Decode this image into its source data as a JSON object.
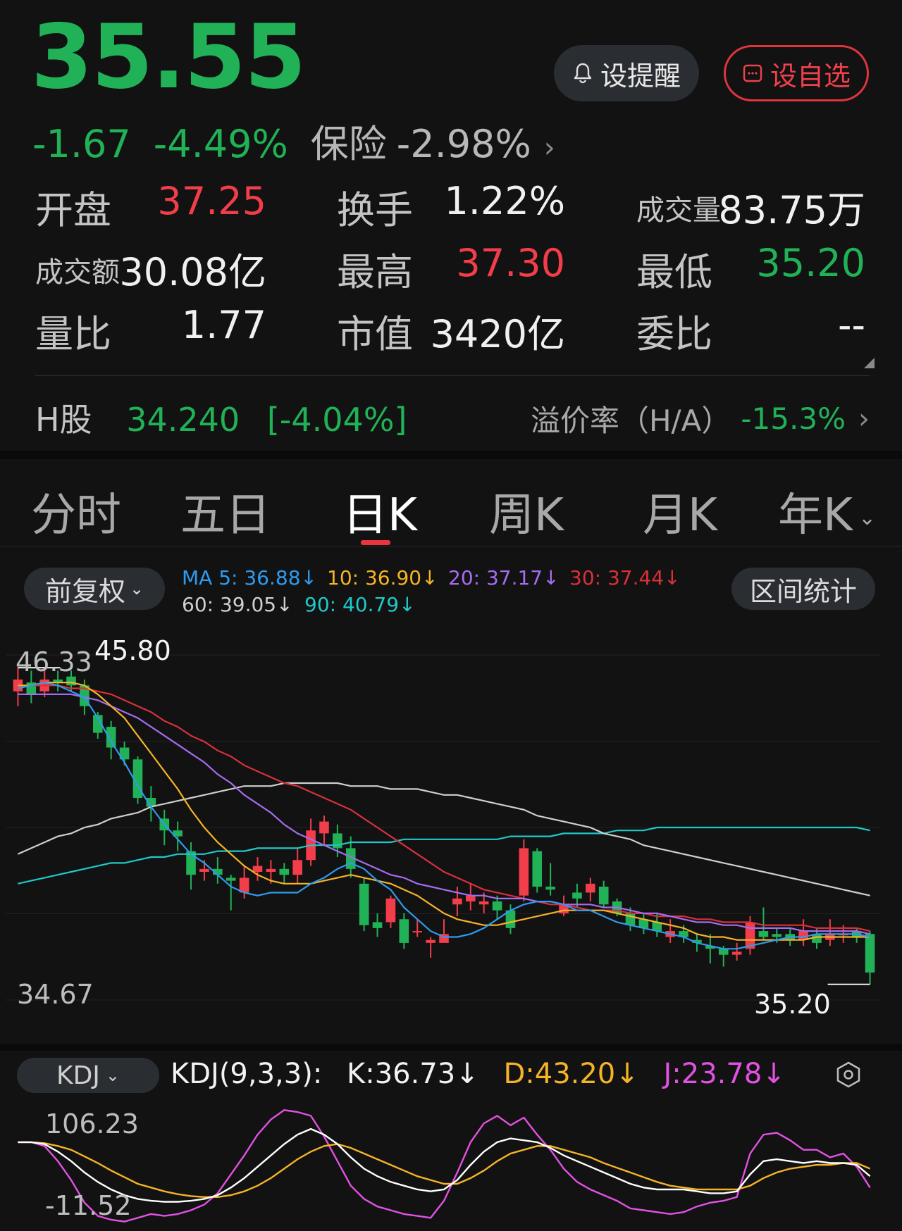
{
  "quote": {
    "price": "35.55",
    "change": "-1.67",
    "change_pct": "-4.49%",
    "sector_name": "保险",
    "sector_change": "-2.98%"
  },
  "buttons": {
    "remind": "设提醒",
    "watchlist": "设自选"
  },
  "stats": {
    "open_label": "开盘",
    "open_value": "37.25",
    "turnover_label": "换手",
    "turnover_value": "1.22%",
    "volume_label": "成交量",
    "volume_value": "83.75万",
    "amount_label": "成交额",
    "amount_value": "30.08亿",
    "high_label": "最高",
    "high_value": "37.30",
    "low_label": "最低",
    "low_value": "35.20",
    "vol_ratio_label": "量比",
    "vol_ratio_value": "1.77",
    "mkt_cap_label": "市值",
    "mkt_cap_value": "3420亿",
    "order_ratio_label": "委比",
    "order_ratio_value": "--"
  },
  "h_share": {
    "label": "H股",
    "value": "34.240",
    "change": "[-4.04%]",
    "premium_label": "溢价率（H/A）",
    "premium_value": "-15.3%"
  },
  "tabs": [
    "分时",
    "五日",
    "日K",
    "周K",
    "月K",
    "年K"
  ],
  "toolbar": {
    "adjust": "前复权",
    "range_stats": "区间统计"
  },
  "ma": {
    "ma5": "MA 5: 36.88↓",
    "ma10": "10: 36.90↓",
    "ma20": "20: 37.17↓",
    "ma30": "30: 37.44↓",
    "ma60": "60: 39.05↓",
    "ma90": "90: 40.79↓"
  },
  "colors": {
    "up": "#f23d4a",
    "down": "#21b257",
    "ma5": "#2e9bef",
    "ma10": "#f5b327",
    "ma20": "#a46cf0",
    "ma30": "#d9303a",
    "ma60": "#cfcfcf",
    "ma90": "#1fc9c9",
    "kdj_k": "#ffffff",
    "kdj_d": "#f5b327",
    "kdj_j": "#e152e2"
  },
  "chart_labels": {
    "y_top": "46.33",
    "y_bottom": "34.67",
    "max_label": "45.80",
    "min_label": "35.20"
  },
  "kdj": {
    "button": "KDJ",
    "title": "KDJ(9,3,3):",
    "k": "K:36.73↓",
    "d": "D:43.20↓",
    "j": "J:23.78↓",
    "y_top": "106.23",
    "y_bottom": "-11.52"
  },
  "chart_data": {
    "type": "candlestick",
    "ylim": [
      34.67,
      46.33
    ],
    "candles": [
      {
        "o": 45.1,
        "c": 45.5,
        "h": 45.9,
        "l": 44.6
      },
      {
        "o": 45.4,
        "c": 45.0,
        "h": 45.8,
        "l": 44.7
      },
      {
        "o": 45.1,
        "c": 45.5,
        "h": 45.8,
        "l": 44.9
      },
      {
        "o": 45.5,
        "c": 45.4,
        "h": 45.8,
        "l": 45.1
      },
      {
        "o": 45.6,
        "c": 45.3,
        "h": 45.8,
        "l": 45.1
      },
      {
        "o": 45.3,
        "c": 44.6,
        "h": 45.5,
        "l": 44.3
      },
      {
        "o": 44.3,
        "c": 43.7,
        "h": 44.4,
        "l": 43.5
      },
      {
        "o": 43.9,
        "c": 43.2,
        "h": 44.1,
        "l": 42.8
      },
      {
        "o": 43.2,
        "c": 42.8,
        "h": 43.4,
        "l": 42.6
      },
      {
        "o": 42.8,
        "c": 41.5,
        "h": 42.9,
        "l": 41.3
      },
      {
        "o": 41.5,
        "c": 41.2,
        "h": 41.9,
        "l": 40.7
      },
      {
        "o": 40.8,
        "c": 40.4,
        "h": 41.1,
        "l": 39.9
      },
      {
        "o": 40.4,
        "c": 40.2,
        "h": 40.7,
        "l": 39.7
      },
      {
        "o": 39.7,
        "c": 38.9,
        "h": 40.0,
        "l": 38.4
      },
      {
        "o": 39.0,
        "c": 39.1,
        "h": 39.4,
        "l": 38.7
      },
      {
        "o": 39.1,
        "c": 38.9,
        "h": 39.5,
        "l": 38.6
      },
      {
        "o": 38.8,
        "c": 38.7,
        "h": 38.9,
        "l": 37.7
      },
      {
        "o": 38.3,
        "c": 38.8,
        "h": 39.2,
        "l": 38.1
      },
      {
        "o": 39.0,
        "c": 39.2,
        "h": 39.5,
        "l": 38.7
      },
      {
        "o": 39.0,
        "c": 39.1,
        "h": 39.4,
        "l": 38.6
      },
      {
        "o": 39.1,
        "c": 38.9,
        "h": 39.3,
        "l": 38.6
      },
      {
        "o": 38.9,
        "c": 39.4,
        "h": 39.8,
        "l": 38.6
      },
      {
        "o": 39.4,
        "c": 40.4,
        "h": 40.8,
        "l": 39.2
      },
      {
        "o": 40.3,
        "c": 40.7,
        "h": 40.9,
        "l": 39.9
      },
      {
        "o": 40.3,
        "c": 39.8,
        "h": 40.6,
        "l": 39.5
      },
      {
        "o": 39.8,
        "c": 39.1,
        "h": 40.2,
        "l": 38.8
      },
      {
        "o": 38.6,
        "c": 37.2,
        "h": 38.8,
        "l": 37.0
      },
      {
        "o": 37.3,
        "c": 37.1,
        "h": 37.6,
        "l": 36.8
      },
      {
        "o": 37.3,
        "c": 38.1,
        "h": 38.2,
        "l": 37.1
      },
      {
        "o": 37.4,
        "c": 36.6,
        "h": 37.6,
        "l": 36.4
      },
      {
        "o": 37.0,
        "c": 37.0,
        "h": 37.4,
        "l": 36.8
      },
      {
        "o": 36.6,
        "c": 36.7,
        "h": 36.8,
        "l": 36.1
      },
      {
        "o": 36.6,
        "c": 36.9,
        "h": 37.4,
        "l": 36.7
      },
      {
        "o": 37.9,
        "c": 38.1,
        "h": 38.5,
        "l": 37.5
      },
      {
        "o": 38.0,
        "c": 38.2,
        "h": 38.6,
        "l": 37.7
      },
      {
        "o": 37.9,
        "c": 38.0,
        "h": 38.3,
        "l": 37.6
      },
      {
        "o": 38.0,
        "c": 37.7,
        "h": 38.2,
        "l": 37.4
      },
      {
        "o": 37.7,
        "c": 37.1,
        "h": 37.9,
        "l": 36.9
      },
      {
        "o": 38.2,
        "c": 39.8,
        "h": 40.1,
        "l": 38.0
      },
      {
        "o": 39.7,
        "c": 38.5,
        "h": 39.8,
        "l": 38.3
      },
      {
        "o": 38.5,
        "c": 38.4,
        "h": 39.3,
        "l": 38.2
      },
      {
        "o": 37.6,
        "c": 37.9,
        "h": 38.2,
        "l": 37.5
      },
      {
        "o": 38.3,
        "c": 38.1,
        "h": 38.6,
        "l": 37.8
      },
      {
        "o": 38.3,
        "c": 38.6,
        "h": 38.8,
        "l": 38.0
      },
      {
        "o": 38.5,
        "c": 37.9,
        "h": 38.7,
        "l": 37.8
      },
      {
        "o": 38.0,
        "c": 37.6,
        "h": 38.1,
        "l": 37.5
      },
      {
        "o": 37.6,
        "c": 37.2,
        "h": 37.8,
        "l": 37.0
      },
      {
        "o": 37.4,
        "c": 37.1,
        "h": 37.6,
        "l": 36.9
      },
      {
        "o": 37.3,
        "c": 37.0,
        "h": 37.6,
        "l": 36.8
      },
      {
        "o": 36.8,
        "c": 37.0,
        "h": 37.4,
        "l": 36.6
      },
      {
        "o": 37.0,
        "c": 36.8,
        "h": 37.2,
        "l": 36.6
      },
      {
        "o": 36.7,
        "c": 36.6,
        "h": 36.9,
        "l": 36.3
      },
      {
        "o": 36.5,
        "c": 36.4,
        "h": 36.9,
        "l": 35.9
      },
      {
        "o": 36.4,
        "c": 36.2,
        "h": 36.5,
        "l": 35.8
      },
      {
        "o": 36.2,
        "c": 36.3,
        "h": 36.6,
        "l": 36.0
      },
      {
        "o": 36.4,
        "c": 37.3,
        "h": 37.5,
        "l": 36.2
      },
      {
        "o": 37.0,
        "c": 36.8,
        "h": 37.8,
        "l": 36.7
      },
      {
        "o": 36.9,
        "c": 36.8,
        "h": 37.1,
        "l": 36.6
      },
      {
        "o": 36.9,
        "c": 36.7,
        "h": 37.1,
        "l": 36.5
      },
      {
        "o": 36.7,
        "c": 37.0,
        "h": 37.4,
        "l": 36.5
      },
      {
        "o": 36.9,
        "c": 36.6,
        "h": 37.1,
        "l": 36.4
      },
      {
        "o": 36.7,
        "c": 36.9,
        "h": 37.4,
        "l": 36.5
      },
      {
        "o": 36.9,
        "c": 36.9,
        "h": 37.2,
        "l": 36.6
      },
      {
        "o": 37.0,
        "c": 36.8,
        "h": 37.1,
        "l": 36.6
      },
      {
        "o": 36.9,
        "c": 35.6,
        "h": 37.0,
        "l": 35.2
      }
    ],
    "ma5": [
      45.2,
      45.3,
      45.4,
      45.3,
      45.1,
      44.9,
      44.2,
      43.4,
      42.7,
      41.9,
      41.2,
      40.6,
      40.1,
      39.6,
      39.3,
      38.9,
      38.5,
      38.3,
      38.2,
      38.3,
      38.3,
      38.3,
      38.6,
      38.8,
      39.1,
      39.3,
      39.1,
      38.7,
      38.4,
      37.8,
      37.4,
      37.0,
      36.8,
      36.8,
      36.9,
      37.1,
      37.4,
      37.7,
      37.9,
      38.0,
      38.0,
      37.9,
      37.7,
      37.7,
      37.5,
      37.3,
      37.2,
      37.1,
      37.0,
      36.9,
      36.8,
      36.6,
      36.5,
      36.4,
      36.4,
      36.5,
      36.6,
      36.7,
      36.8,
      36.8,
      36.9,
      36.9,
      36.9,
      36.9,
      36.8
    ],
    "ma10": [
      45.3,
      45.3,
      45.4,
      45.4,
      45.4,
      45.3,
      45.0,
      44.6,
      44.2,
      43.6,
      43.0,
      42.4,
      41.8,
      41.1,
      40.5,
      40.0,
      39.6,
      39.2,
      38.9,
      38.7,
      38.6,
      38.6,
      38.6,
      38.7,
      38.8,
      38.9,
      38.8,
      38.7,
      38.6,
      38.4,
      38.2,
      37.9,
      37.6,
      37.4,
      37.3,
      37.2,
      37.2,
      37.3,
      37.4,
      37.5,
      37.6,
      37.7,
      37.7,
      37.7,
      37.7,
      37.6,
      37.5,
      37.4,
      37.3,
      37.2,
      37.1,
      36.9,
      36.8,
      36.8,
      36.7,
      36.7,
      36.7,
      36.7,
      36.7,
      36.7,
      36.8,
      36.8,
      36.8,
      36.8,
      36.8
    ],
    "ma20": [
      45.0,
      45.0,
      45.0,
      45.0,
      45.0,
      44.9,
      44.8,
      44.6,
      44.4,
      44.2,
      43.9,
      43.6,
      43.3,
      43.0,
      42.7,
      42.3,
      42.0,
      41.6,
      41.3,
      41.0,
      40.6,
      40.3,
      40.1,
      39.9,
      39.7,
      39.5,
      39.3,
      39.1,
      38.9,
      38.8,
      38.6,
      38.5,
      38.4,
      38.3,
      38.2,
      38.2,
      38.1,
      38.1,
      38.1,
      38.0,
      38.0,
      37.9,
      37.9,
      37.9,
      37.8,
      37.8,
      37.7,
      37.6,
      37.6,
      37.5,
      37.4,
      37.3,
      37.3,
      37.2,
      37.2,
      37.1,
      37.1,
      37.1,
      37.1,
      37.0,
      37.0,
      37.0,
      37.0,
      37.0,
      36.9
    ],
    "ma30": [
      45.3,
      45.3,
      45.3,
      45.3,
      45.2,
      45.2,
      45.1,
      45.0,
      44.8,
      44.6,
      44.4,
      44.1,
      43.9,
      43.6,
      43.4,
      43.1,
      42.9,
      42.6,
      42.4,
      42.2,
      42.0,
      41.9,
      41.7,
      41.5,
      41.3,
      41.1,
      40.8,
      40.5,
      40.2,
      39.9,
      39.6,
      39.3,
      39.0,
      38.8,
      38.6,
      38.4,
      38.3,
      38.2,
      38.1,
      38.0,
      37.9,
      37.9,
      37.8,
      37.7,
      37.7,
      37.7,
      37.6,
      37.6,
      37.5,
      37.5,
      37.5,
      37.4,
      37.4,
      37.3,
      37.3,
      37.3,
      37.2,
      37.2,
      37.2,
      37.2,
      37.1,
      37.1,
      37.1,
      37.1,
      37.0
    ],
    "ma60": [
      39.6,
      39.8,
      40.0,
      40.2,
      40.3,
      40.5,
      40.6,
      40.8,
      40.9,
      41.0,
      41.2,
      41.3,
      41.4,
      41.5,
      41.6,
      41.7,
      41.8,
      41.9,
      41.9,
      41.9,
      42.0,
      42.0,
      42.0,
      42.0,
      42.0,
      41.9,
      41.9,
      41.9,
      41.8,
      41.8,
      41.8,
      41.7,
      41.6,
      41.6,
      41.5,
      41.4,
      41.3,
      41.2,
      41.1,
      40.9,
      40.8,
      40.7,
      40.6,
      40.5,
      40.3,
      40.2,
      40.1,
      39.9,
      39.8,
      39.7,
      39.6,
      39.5,
      39.4,
      39.3,
      39.2,
      39.1,
      39.0,
      38.9,
      38.8,
      38.7,
      38.6,
      38.5,
      38.4,
      38.3,
      38.2
    ],
    "ma90": [
      38.6,
      38.7,
      38.8,
      38.9,
      39.0,
      39.1,
      39.2,
      39.3,
      39.3,
      39.4,
      39.5,
      39.5,
      39.6,
      39.6,
      39.6,
      39.7,
      39.7,
      39.7,
      39.8,
      39.8,
      39.8,
      39.8,
      39.9,
      39.9,
      39.9,
      40.0,
      40.0,
      40.0,
      40.0,
      40.1,
      40.1,
      40.1,
      40.1,
      40.1,
      40.1,
      40.1,
      40.1,
      40.2,
      40.2,
      40.2,
      40.2,
      40.3,
      40.3,
      40.3,
      40.3,
      40.4,
      40.4,
      40.4,
      40.5,
      40.5,
      40.5,
      40.5,
      40.5,
      40.5,
      40.5,
      40.5,
      40.5,
      40.5,
      40.5,
      40.5,
      40.5,
      40.5,
      40.5,
      40.5,
      40.4
    ],
    "kdj": {
      "ylim": [
        -11.52,
        106.23
      ],
      "k": [
        72,
        72,
        70,
        62,
        52,
        40,
        30,
        22,
        16,
        12,
        10,
        9,
        9,
        10,
        12,
        16,
        24,
        34,
        46,
        58,
        70,
        80,
        86,
        80,
        70,
        56,
        44,
        36,
        30,
        26,
        22,
        20,
        22,
        32,
        48,
        62,
        72,
        76,
        74,
        72,
        66,
        58,
        52,
        46,
        40,
        34,
        28,
        24,
        22,
        22,
        22,
        20,
        18,
        18,
        20,
        38,
        52,
        54,
        52,
        50,
        52,
        50,
        50,
        48,
        36
      ],
      "d": [
        72,
        72,
        71,
        68,
        64,
        57,
        50,
        42,
        35,
        28,
        24,
        20,
        17,
        15,
        14,
        14,
        16,
        20,
        26,
        34,
        44,
        54,
        62,
        68,
        70,
        66,
        60,
        54,
        48,
        42,
        36,
        32,
        28,
        28,
        34,
        42,
        52,
        60,
        64,
        68,
        68,
        64,
        60,
        56,
        50,
        45,
        40,
        35,
        30,
        26,
        24,
        22,
        22,
        22,
        22,
        26,
        34,
        40,
        44,
        46,
        48,
        48,
        50,
        50,
        44
      ],
      "j": [
        72,
        72,
        68,
        52,
        32,
        8,
        -6,
        -10,
        -12,
        -8,
        -4,
        -6,
        -4,
        0,
        6,
        18,
        38,
        58,
        80,
        96,
        106,
        104,
        100,
        78,
        52,
        26,
        12,
        4,
        0,
        -4,
        -6,
        -8,
        10,
        40,
        72,
        92,
        100,
        90,
        98,
        80,
        64,
        44,
        30,
        22,
        16,
        10,
        2,
        0,
        -2,
        -4,
        -2,
        4,
        8,
        10,
        14,
        60,
        80,
        82,
        74,
        64,
        64,
        56,
        60,
        46,
        24
      ]
    }
  }
}
